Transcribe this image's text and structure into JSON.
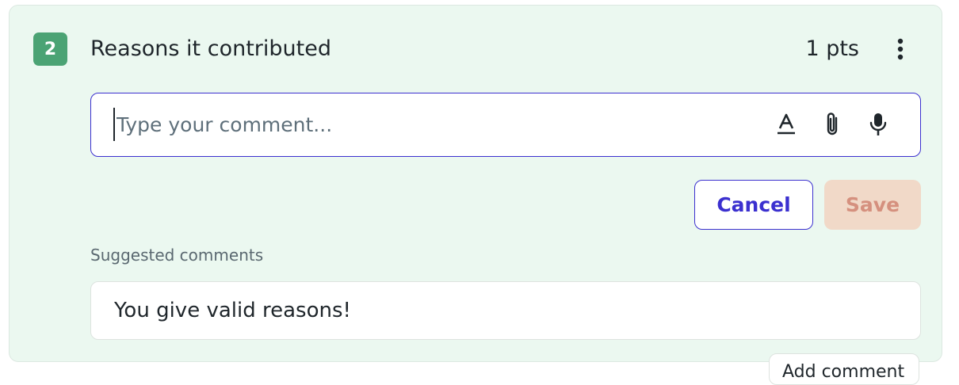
{
  "criterion": {
    "number": "2",
    "title": "Reasons it contributed",
    "points": "1 pts"
  },
  "comment_editor": {
    "placeholder": "Type your comment...",
    "value": "",
    "tools": [
      "text-format-icon",
      "paperclip-icon",
      "microphone-icon"
    ]
  },
  "actions": {
    "cancel_label": "Cancel",
    "save_label": "Save"
  },
  "suggestions": {
    "label": "Suggested comments",
    "items": [
      "You give valid reasons!"
    ]
  },
  "floating": {
    "add_comment_label": "Add comment"
  },
  "colors": {
    "card_bg": "#ebf8f0",
    "badge": "#4ba374",
    "accent": "#3b30cf",
    "save_disabled_bg": "#f1d9c8",
    "save_disabled_text": "#d5907e"
  }
}
